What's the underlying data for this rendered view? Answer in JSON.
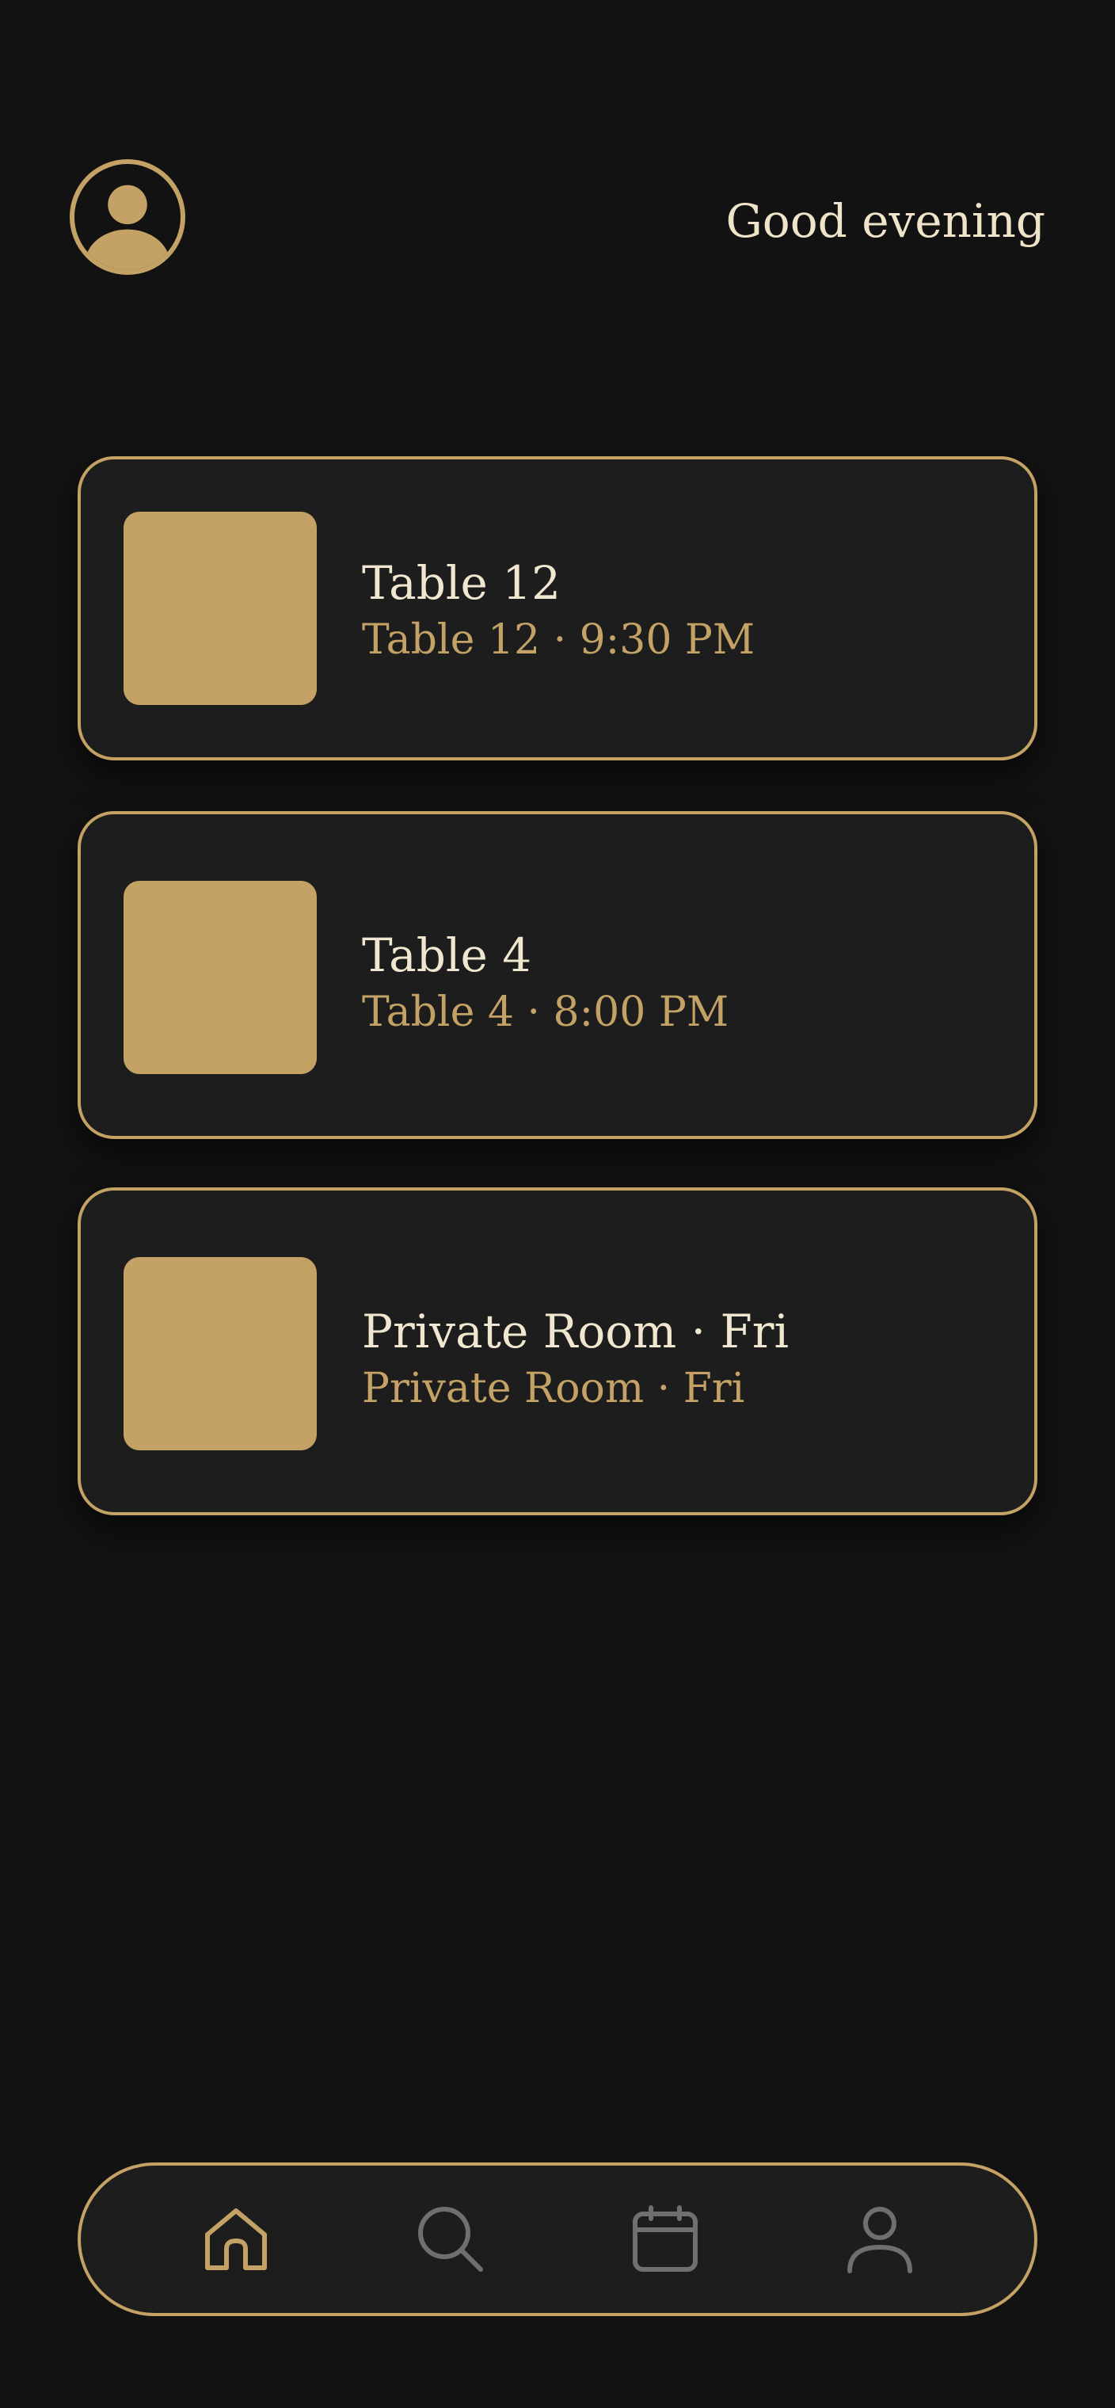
{
  "header": {
    "avatar_icon": "user-avatar-icon",
    "greeting": "Good evening"
  },
  "reservations": [
    {
      "title": "Table 12",
      "subtitle": "Table 12 · 9:30 PM"
    },
    {
      "title": "Table 4",
      "subtitle": "Table 4 · 8:00 PM"
    },
    {
      "title": "Private Room · Fri",
      "subtitle": "Private Room · Fri"
    }
  ],
  "bottom_nav": {
    "items": [
      {
        "icon": "home-icon",
        "active": true
      },
      {
        "icon": "search-icon",
        "active": false
      },
      {
        "icon": "calendar-icon",
        "active": false
      },
      {
        "icon": "profile-icon",
        "active": false
      }
    ]
  },
  "colors": {
    "background": "#121212",
    "card": "#1d1d1d",
    "accent": "#c4a265",
    "text_primary": "#f1e6cf",
    "icon_inactive": "#6f6f6f"
  }
}
